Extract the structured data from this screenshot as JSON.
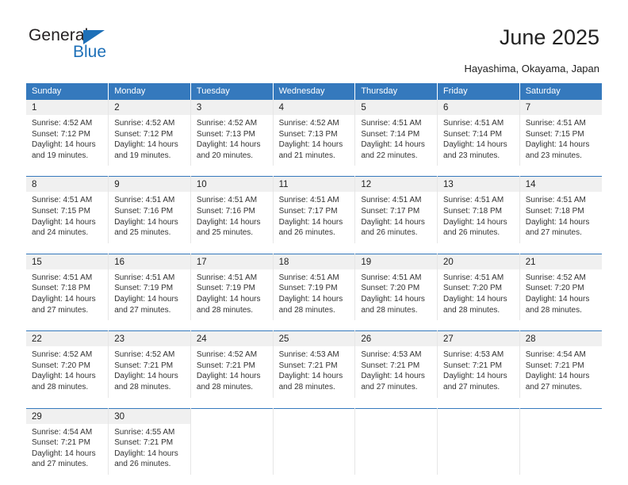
{
  "brand": {
    "name_part1": "General",
    "name_part2": "Blue",
    "triangle_color": "#1e70b8"
  },
  "header": {
    "title": "June 2025",
    "subtitle": "Hayashima, Okayama, Japan",
    "accent_color": "#3579bd"
  },
  "weekdays": [
    "Sunday",
    "Monday",
    "Tuesday",
    "Wednesday",
    "Thursday",
    "Friday",
    "Saturday"
  ],
  "labels": {
    "sunrise_prefix": "Sunrise:",
    "sunset_prefix": "Sunset:",
    "daylight_prefix": "Daylight:"
  },
  "days": [
    {
      "n": "1",
      "sunrise": "Sunrise: 4:52 AM",
      "sunset": "Sunset: 7:12 PM",
      "daylight1": "Daylight: 14 hours",
      "daylight2": "and 19 minutes."
    },
    {
      "n": "2",
      "sunrise": "Sunrise: 4:52 AM",
      "sunset": "Sunset: 7:12 PM",
      "daylight1": "Daylight: 14 hours",
      "daylight2": "and 19 minutes."
    },
    {
      "n": "3",
      "sunrise": "Sunrise: 4:52 AM",
      "sunset": "Sunset: 7:13 PM",
      "daylight1": "Daylight: 14 hours",
      "daylight2": "and 20 minutes."
    },
    {
      "n": "4",
      "sunrise": "Sunrise: 4:52 AM",
      "sunset": "Sunset: 7:13 PM",
      "daylight1": "Daylight: 14 hours",
      "daylight2": "and 21 minutes."
    },
    {
      "n": "5",
      "sunrise": "Sunrise: 4:51 AM",
      "sunset": "Sunset: 7:14 PM",
      "daylight1": "Daylight: 14 hours",
      "daylight2": "and 22 minutes."
    },
    {
      "n": "6",
      "sunrise": "Sunrise: 4:51 AM",
      "sunset": "Sunset: 7:14 PM",
      "daylight1": "Daylight: 14 hours",
      "daylight2": "and 23 minutes."
    },
    {
      "n": "7",
      "sunrise": "Sunrise: 4:51 AM",
      "sunset": "Sunset: 7:15 PM",
      "daylight1": "Daylight: 14 hours",
      "daylight2": "and 23 minutes."
    },
    {
      "n": "8",
      "sunrise": "Sunrise: 4:51 AM",
      "sunset": "Sunset: 7:15 PM",
      "daylight1": "Daylight: 14 hours",
      "daylight2": "and 24 minutes."
    },
    {
      "n": "9",
      "sunrise": "Sunrise: 4:51 AM",
      "sunset": "Sunset: 7:16 PM",
      "daylight1": "Daylight: 14 hours",
      "daylight2": "and 25 minutes."
    },
    {
      "n": "10",
      "sunrise": "Sunrise: 4:51 AM",
      "sunset": "Sunset: 7:16 PM",
      "daylight1": "Daylight: 14 hours",
      "daylight2": "and 25 minutes."
    },
    {
      "n": "11",
      "sunrise": "Sunrise: 4:51 AM",
      "sunset": "Sunset: 7:17 PM",
      "daylight1": "Daylight: 14 hours",
      "daylight2": "and 26 minutes."
    },
    {
      "n": "12",
      "sunrise": "Sunrise: 4:51 AM",
      "sunset": "Sunset: 7:17 PM",
      "daylight1": "Daylight: 14 hours",
      "daylight2": "and 26 minutes."
    },
    {
      "n": "13",
      "sunrise": "Sunrise: 4:51 AM",
      "sunset": "Sunset: 7:18 PM",
      "daylight1": "Daylight: 14 hours",
      "daylight2": "and 26 minutes."
    },
    {
      "n": "14",
      "sunrise": "Sunrise: 4:51 AM",
      "sunset": "Sunset: 7:18 PM",
      "daylight1": "Daylight: 14 hours",
      "daylight2": "and 27 minutes."
    },
    {
      "n": "15",
      "sunrise": "Sunrise: 4:51 AM",
      "sunset": "Sunset: 7:18 PM",
      "daylight1": "Daylight: 14 hours",
      "daylight2": "and 27 minutes."
    },
    {
      "n": "16",
      "sunrise": "Sunrise: 4:51 AM",
      "sunset": "Sunset: 7:19 PM",
      "daylight1": "Daylight: 14 hours",
      "daylight2": "and 27 minutes."
    },
    {
      "n": "17",
      "sunrise": "Sunrise: 4:51 AM",
      "sunset": "Sunset: 7:19 PM",
      "daylight1": "Daylight: 14 hours",
      "daylight2": "and 28 minutes."
    },
    {
      "n": "18",
      "sunrise": "Sunrise: 4:51 AM",
      "sunset": "Sunset: 7:19 PM",
      "daylight1": "Daylight: 14 hours",
      "daylight2": "and 28 minutes."
    },
    {
      "n": "19",
      "sunrise": "Sunrise: 4:51 AM",
      "sunset": "Sunset: 7:20 PM",
      "daylight1": "Daylight: 14 hours",
      "daylight2": "and 28 minutes."
    },
    {
      "n": "20",
      "sunrise": "Sunrise: 4:51 AM",
      "sunset": "Sunset: 7:20 PM",
      "daylight1": "Daylight: 14 hours",
      "daylight2": "and 28 minutes."
    },
    {
      "n": "21",
      "sunrise": "Sunrise: 4:52 AM",
      "sunset": "Sunset: 7:20 PM",
      "daylight1": "Daylight: 14 hours",
      "daylight2": "and 28 minutes."
    },
    {
      "n": "22",
      "sunrise": "Sunrise: 4:52 AM",
      "sunset": "Sunset: 7:20 PM",
      "daylight1": "Daylight: 14 hours",
      "daylight2": "and 28 minutes."
    },
    {
      "n": "23",
      "sunrise": "Sunrise: 4:52 AM",
      "sunset": "Sunset: 7:21 PM",
      "daylight1": "Daylight: 14 hours",
      "daylight2": "and 28 minutes."
    },
    {
      "n": "24",
      "sunrise": "Sunrise: 4:52 AM",
      "sunset": "Sunset: 7:21 PM",
      "daylight1": "Daylight: 14 hours",
      "daylight2": "and 28 minutes."
    },
    {
      "n": "25",
      "sunrise": "Sunrise: 4:53 AM",
      "sunset": "Sunset: 7:21 PM",
      "daylight1": "Daylight: 14 hours",
      "daylight2": "and 28 minutes."
    },
    {
      "n": "26",
      "sunrise": "Sunrise: 4:53 AM",
      "sunset": "Sunset: 7:21 PM",
      "daylight1": "Daylight: 14 hours",
      "daylight2": "and 27 minutes."
    },
    {
      "n": "27",
      "sunrise": "Sunrise: 4:53 AM",
      "sunset": "Sunset: 7:21 PM",
      "daylight1": "Daylight: 14 hours",
      "daylight2": "and 27 minutes."
    },
    {
      "n": "28",
      "sunrise": "Sunrise: 4:54 AM",
      "sunset": "Sunset: 7:21 PM",
      "daylight1": "Daylight: 14 hours",
      "daylight2": "and 27 minutes."
    },
    {
      "n": "29",
      "sunrise": "Sunrise: 4:54 AM",
      "sunset": "Sunset: 7:21 PM",
      "daylight1": "Daylight: 14 hours",
      "daylight2": "and 27 minutes."
    },
    {
      "n": "30",
      "sunrise": "Sunrise: 4:55 AM",
      "sunset": "Sunset: 7:21 PM",
      "daylight1": "Daylight: 14 hours",
      "daylight2": "and 26 minutes."
    }
  ],
  "grid": {
    "leading_blanks": 0,
    "trailing_blanks": 5
  }
}
